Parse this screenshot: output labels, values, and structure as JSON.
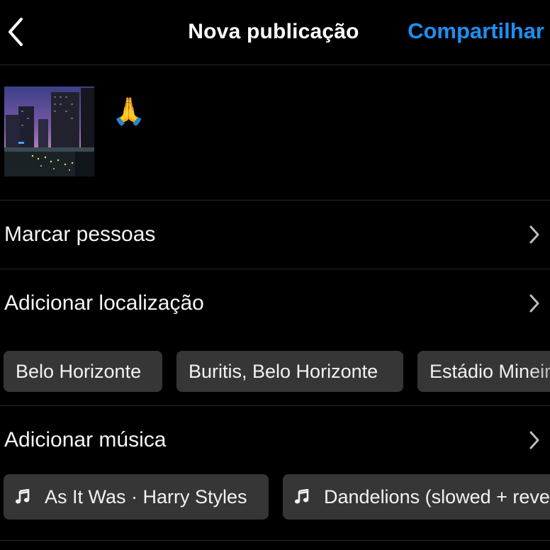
{
  "header": {
    "title": "Nova publicação",
    "share_label": "Compartilhar",
    "back_icon": "chevron-left-icon"
  },
  "post": {
    "caption": "🙏",
    "thumbnail": "city-dusk-photo"
  },
  "rows": {
    "tag_people": "Marcar pessoas",
    "add_location": "Adicionar localização",
    "add_music": "Adicionar música"
  },
  "location_suggestions": [
    "Belo Horizonte",
    "Buritis, Belo Horizonte",
    "Estádio Mineirão"
  ],
  "music_suggestions": [
    "As It Was · Harry Styles",
    "Dandelions (slowed + reverb)"
  ],
  "colors": {
    "background": "#000000",
    "accent": "#1e8ff0",
    "chip": "#363636",
    "divider": "#262626"
  }
}
